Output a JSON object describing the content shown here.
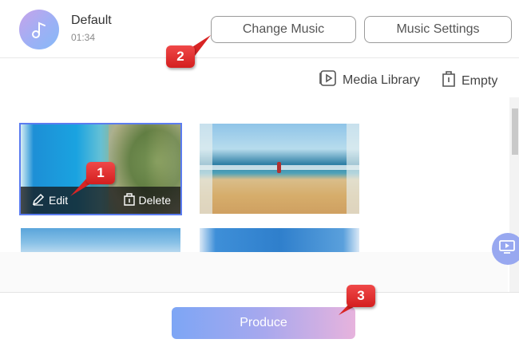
{
  "header": {
    "track_name": "Default",
    "track_duration": "01:34",
    "change_music_label": "Change Music",
    "music_settings_label": "Music Settings"
  },
  "toolbar": {
    "media_library_label": "Media Library",
    "empty_label": "Empty"
  },
  "media_items": [
    {
      "edit_label": "Edit",
      "delete_label": "Delete",
      "selected": true
    }
  ],
  "footer": {
    "produce_label": "Produce"
  },
  "callouts": [
    "1",
    "2",
    "3"
  ],
  "colors": {
    "accent_blue": "#5b7cf0",
    "callout_red": "#e03030",
    "produce_gradient_start": "#7da6f5",
    "produce_gradient_end": "#e7b3dd"
  },
  "icons": [
    "music-note-icon",
    "media-library-icon",
    "trash-icon",
    "edit-icon",
    "delete-icon",
    "screen-record-icon"
  ]
}
